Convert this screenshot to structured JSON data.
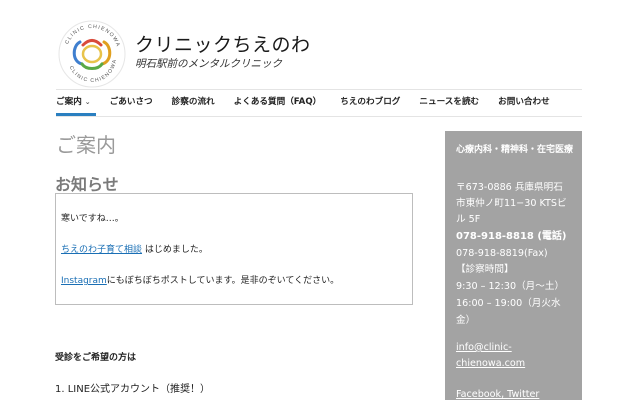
{
  "header": {
    "logo_text": "CLINIC CHIENOWA",
    "title": "クリニックちえのわ",
    "tagline": "明石駅前のメンタルクリニック"
  },
  "nav": {
    "items": [
      {
        "label": "ご案内",
        "active": true,
        "has_dropdown": true
      },
      {
        "label": "ごあいさつ"
      },
      {
        "label": "診察の流れ"
      },
      {
        "label": "よくある質問（FAQ）"
      },
      {
        "label": "ちえのわブログ"
      },
      {
        "label": "ニュースを読む"
      },
      {
        "label": "お問い合わせ"
      }
    ],
    "active_color": "#2a7fc0"
  },
  "main": {
    "page_heading": "ご案内",
    "section_heading": "お知らせ",
    "notice": {
      "line1": "寒いですね…。",
      "line2_link": "ちえのわ子育て相談",
      "line2_rest": " はじめました。",
      "line3_link": "Instagram",
      "line3_rest": "にもぼちぼちポストしています。是非のぞいてください。"
    },
    "visit_heading": "受診をご希望の方は",
    "visit_item_1": "1. LINE公式アカウント（推奨！）"
  },
  "sidebar": {
    "title": "心療内科・精神科・在宅医療",
    "address_lines": [
      "〒673-0886 兵庫県明石",
      "市東仲ノ町11−30 KTSビ",
      "ル 5F"
    ],
    "phone": "078-918-8818 (電話)",
    "fax": "078-918-8819(Fax)",
    "hours_label": "【診察時間】",
    "hours_lines": [
      "9:30 – 12:30（月〜土）",
      "16:00 – 19:00（月火水",
      "金）"
    ],
    "email_lines": [
      "info@clinic-",
      "chienowa.com"
    ],
    "social": "Facebook, Twitter",
    "bg_color": "#a3a3a3"
  }
}
